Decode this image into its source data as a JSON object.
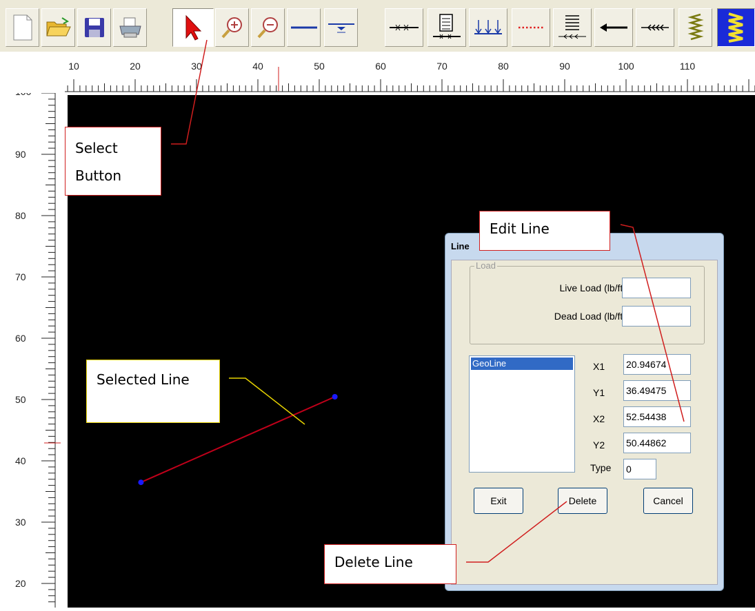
{
  "toolbar": {
    "buttons": [
      {
        "icon": "new-document-icon"
      },
      {
        "icon": "open-folder-icon"
      },
      {
        "icon": "save-icon"
      },
      {
        "icon": "print-icon"
      },
      {
        "icon": "select-arrow-icon",
        "pressed": true
      },
      {
        "icon": "zoom-in-icon"
      },
      {
        "icon": "zoom-out-icon"
      },
      {
        "icon": "line-icon"
      },
      {
        "icon": "water-line-icon"
      },
      {
        "icon": "geo-line-icon"
      },
      {
        "icon": "distributed-load-icon"
      },
      {
        "icon": "point-loads-icon"
      },
      {
        "icon": "dotted-line-icon"
      },
      {
        "icon": "layered-load-icon"
      },
      {
        "icon": "arrow-left-icon"
      },
      {
        "icon": "multi-arrow-icon"
      },
      {
        "icon": "spring-icon"
      },
      {
        "icon": "layers-icon"
      }
    ]
  },
  "ruler": {
    "x_labels": [
      "10",
      "20",
      "30",
      "40",
      "50",
      "60",
      "70",
      "80",
      "90",
      "100",
      "110"
    ],
    "y_labels": [
      "90",
      "80",
      "70",
      "60",
      "50",
      "40",
      "30",
      "20"
    ],
    "y_top_partial": "100"
  },
  "canvas": {
    "selected_line": {
      "x1": 20.94674,
      "y1": 36.49475,
      "x2": 52.54438,
      "y2": 50.44862,
      "color": "#c0001a",
      "point_color": "#1a1aff"
    }
  },
  "dialog": {
    "title": "Line",
    "load_group": "Load",
    "live_load_label": "Live Load (lb/ft)",
    "live_load_value": "",
    "dead_load_label": "Dead Load (lb/ft)",
    "dead_load_value": "",
    "list_items": [
      "GeoLine"
    ],
    "x1_label": "X1",
    "x1_value": "20.94674",
    "y1_label": "Y1",
    "y1_value": "36.49475",
    "x2_label": "X2",
    "x2_value": "52.54438",
    "y2_label": "Y2",
    "y2_value": "50.44862",
    "type_label": "Type",
    "type_value": "0",
    "exit_label": "Exit",
    "delete_label": "Delete",
    "cancel_label": "Cancel"
  },
  "callouts": {
    "select_button": "Select Button",
    "edit_line": "Edit Line",
    "selected_line": "Selected Line",
    "delete_line": "Delete Line"
  },
  "colors": {
    "callout_red": "#d01e1e",
    "callout_yellow": "#e6d200",
    "canvas_bg": "#000000"
  }
}
